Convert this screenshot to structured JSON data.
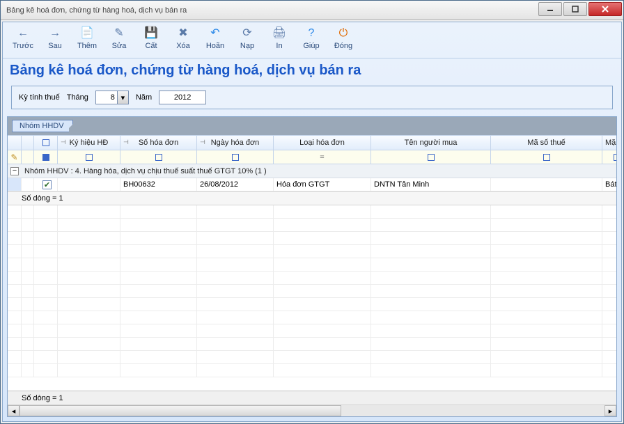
{
  "window": {
    "title": "Bảng kê hoá đơn, chứng từ hàng hoá, dịch vụ bán ra"
  },
  "toolbar": {
    "items": [
      {
        "id": "back",
        "label": "Trước",
        "glyph": "←",
        "color": "#5a7aa8"
      },
      {
        "id": "next",
        "label": "Sau",
        "glyph": "→",
        "color": "#5a7aa8"
      },
      {
        "id": "add",
        "label": "Thêm",
        "glyph": "📄",
        "color": "#5a7aa8"
      },
      {
        "id": "edit",
        "label": "Sửa",
        "glyph": "✎",
        "color": "#5a7aa8"
      },
      {
        "id": "save",
        "label": "Cất",
        "glyph": "💾",
        "color": "#1a58c8"
      },
      {
        "id": "delete",
        "label": "Xóa",
        "glyph": "✖",
        "color": "#5a7aa8"
      },
      {
        "id": "undo",
        "label": "Hoãn",
        "glyph": "↶",
        "color": "#2a88e8"
      },
      {
        "id": "load",
        "label": "Nạp",
        "glyph": "⟳",
        "color": "#5a7aa8"
      },
      {
        "id": "print",
        "label": "In",
        "glyph": "🖨",
        "color": "#5a7aa8"
      },
      {
        "id": "help",
        "label": "Giúp",
        "glyph": "?",
        "color": "#2a88e8"
      },
      {
        "id": "close",
        "label": "Đóng",
        "glyph": "⏻",
        "color": "#e06a00"
      }
    ]
  },
  "heading": "Bảng kê hoá đơn, chứng từ hàng hoá, dịch vụ bán ra",
  "filter": {
    "period_label": "Kỳ tính thuế",
    "month_label": "Tháng",
    "month_value": "8",
    "year_label": "Năm",
    "year_value": "2012"
  },
  "grid": {
    "group_by_pill": "Nhóm HHDV",
    "columns": {
      "ky_hieu": "Ký hiệu HĐ",
      "so_hd": "Số hóa đơn",
      "ngay_hd": "Ngày hóa đơn",
      "loai_hd": "Loại hóa đơn",
      "ten_mua": "Tên người mua",
      "mst": "Mã số thuế",
      "mh_trunc": "Mặ"
    },
    "group_header": "Nhóm HHDV : 4. Hàng hóa, dịch vụ chịu thuế suất thuế GTGT 10% (1 )",
    "rows": [
      {
        "checked": true,
        "ky_hieu": "",
        "so_hd": "BH00632",
        "ngay_hd": "26/08/2012",
        "loai_hd": "Hóa đơn GTGT",
        "ten_mua": "DNTN Tân Minh",
        "mst": "",
        "mh": "Bát liên h"
      }
    ],
    "subtotal_text": "Số dòng = 1",
    "grandtotal_text": "Số dòng = 1",
    "filter_eq": "="
  }
}
